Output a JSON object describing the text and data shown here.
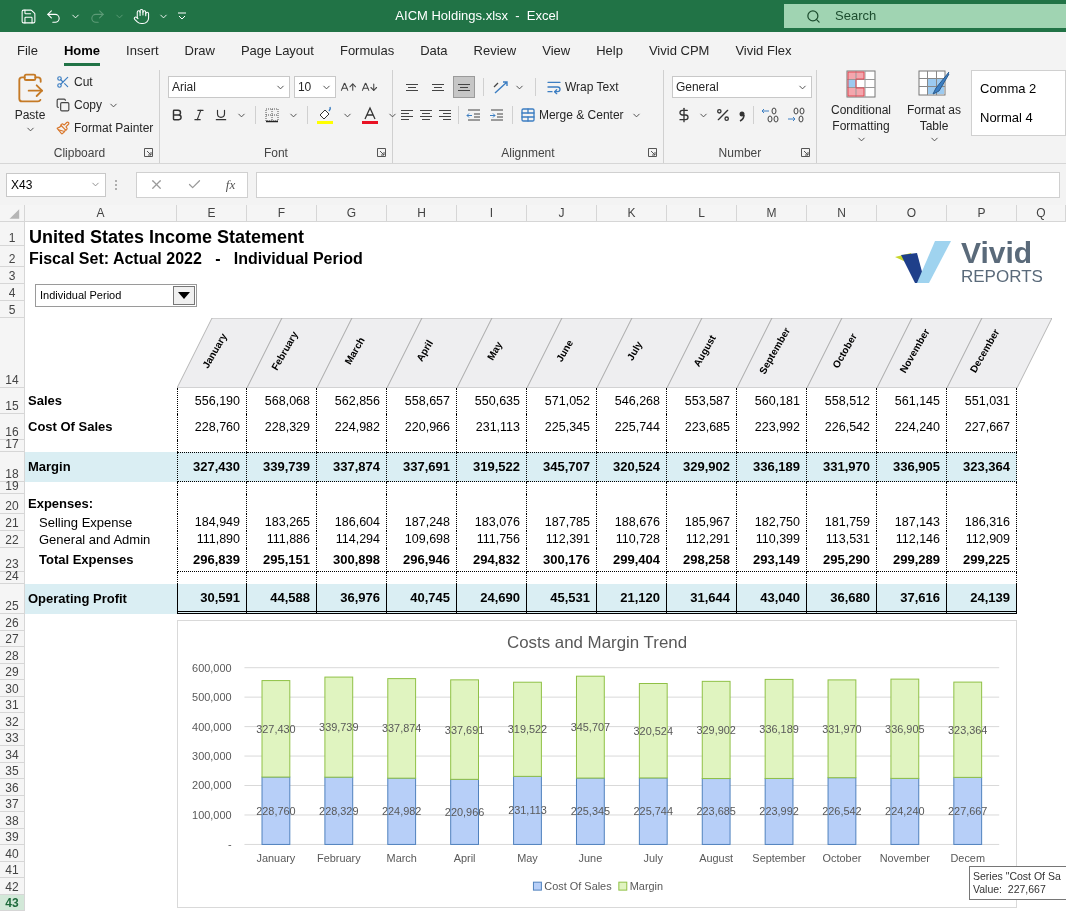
{
  "title_bar": {
    "title": "AICM Holdings.xlsx  -  Excel",
    "search_placeholder": "Search"
  },
  "tabs": [
    {
      "label": "File",
      "selected": false
    },
    {
      "label": "Home",
      "selected": true
    },
    {
      "label": "Insert",
      "selected": false
    },
    {
      "label": "Draw",
      "selected": false
    },
    {
      "label": "Page Layout",
      "selected": false
    },
    {
      "label": "Formulas",
      "selected": false
    },
    {
      "label": "Data",
      "selected": false
    },
    {
      "label": "Review",
      "selected": false
    },
    {
      "label": "View",
      "selected": false
    },
    {
      "label": "Help",
      "selected": false
    },
    {
      "label": "Vivid CPM",
      "selected": false
    },
    {
      "label": "Vivid Flex",
      "selected": false
    }
  ],
  "ribbon": {
    "clipboard": {
      "paste": "Paste",
      "cut": "Cut",
      "copy": "Copy",
      "format_painter": "Format Painter",
      "group": "Clipboard"
    },
    "font": {
      "name": "Arial",
      "size": "10",
      "group": "Font"
    },
    "alignment": {
      "vertical_buttons": [
        {
          "selected": false
        },
        {
          "selected": false
        },
        {
          "selected": true
        }
      ],
      "wrap": "Wrap Text",
      "merge": "Merge & Center",
      "group": "Alignment"
    },
    "number": {
      "format": "General",
      "group": "Number"
    },
    "styles": {
      "conditional": "Conditional Formatting",
      "format_table": "Format as Table",
      "gallery": [
        "Comma 2",
        "Normal 4"
      ]
    }
  },
  "formula_bar": {
    "name_box": "X43",
    "function_label": "fx"
  },
  "column_headers": [
    "A",
    "E",
    "F",
    "G",
    "H",
    "I",
    "J",
    "K",
    "L",
    "M",
    "N",
    "O",
    "P",
    "Q"
  ],
  "sheet": {
    "dropdown": "Individual Period",
    "logo": {
      "word": "Vivid",
      "tagline": "REPORTS"
    },
    "months": [
      "January",
      "February",
      "March",
      "April",
      "May",
      "June",
      "July",
      "August",
      "September",
      "October",
      "November",
      "December"
    ],
    "rows": [
      {
        "num": "1",
        "kind": "title",
        "label": "United States Income Statement"
      },
      {
        "num": "2",
        "kind": "subtitle",
        "label": "Fiscal Set: Actual 2022   -   Individual Period"
      },
      {
        "num": "3",
        "kind": "blank"
      },
      {
        "num": "4",
        "kind": "blank"
      },
      {
        "num": "5",
        "kind": "blank"
      },
      {
        "num": "14",
        "kind": "header"
      },
      {
        "num": "15",
        "kind": "line",
        "label": "Sales",
        "values": [
          "556,190",
          "568,068",
          "562,856",
          "558,657",
          "550,635",
          "571,052",
          "546,268",
          "553,587",
          "560,181",
          "558,512",
          "561,145",
          "551,031"
        ]
      },
      {
        "num": "16",
        "kind": "line",
        "label": "Cost Of Sales",
        "values": [
          "228,760",
          "228,329",
          "224,982",
          "220,966",
          "231,113",
          "225,345",
          "225,744",
          "223,685",
          "223,992",
          "226,542",
          "224,240",
          "227,667"
        ]
      },
      {
        "num": "17",
        "kind": "gap"
      },
      {
        "num": "18",
        "kind": "highlight",
        "label": "Margin",
        "values": [
          "327,430",
          "339,739",
          "337,874",
          "337,691",
          "319,522",
          "345,707",
          "320,524",
          "329,902",
          "336,189",
          "331,970",
          "336,905",
          "323,364"
        ]
      },
      {
        "num": "19",
        "kind": "gap"
      },
      {
        "num": "20",
        "kind": "heading",
        "label": "Expenses:"
      },
      {
        "num": "21",
        "kind": "detail",
        "label": "Selling Expense",
        "values": [
          "184,949",
          "183,265",
          "186,604",
          "187,248",
          "183,076",
          "187,785",
          "188,676",
          "185,967",
          "182,750",
          "181,759",
          "187,143",
          "186,316"
        ]
      },
      {
        "num": "22",
        "kind": "detail",
        "label": "General and Admin",
        "values": [
          "111,890",
          "111,886",
          "114,294",
          "109,698",
          "111,756",
          "112,391",
          "110,728",
          "112,291",
          "110,399",
          "113,531",
          "112,146",
          "112,909"
        ]
      },
      {
        "num": "23",
        "kind": "total",
        "label": "Total Expenses",
        "values": [
          "296,839",
          "295,151",
          "300,898",
          "296,946",
          "294,832",
          "300,176",
          "299,404",
          "298,258",
          "293,149",
          "295,290",
          "299,289",
          "299,225"
        ]
      },
      {
        "num": "24",
        "kind": "gap"
      },
      {
        "num": "25",
        "kind": "result",
        "label": "Operating Profit",
        "values": [
          "30,591",
          "44,588",
          "36,976",
          "40,745",
          "24,690",
          "45,531",
          "21,120",
          "31,644",
          "43,040",
          "36,680",
          "37,616",
          "24,139"
        ]
      }
    ],
    "lower_rows": [
      {
        "num": "26",
        "selected": false
      },
      {
        "num": "27",
        "selected": false
      },
      {
        "num": "28",
        "selected": false
      },
      {
        "num": "29",
        "selected": false
      },
      {
        "num": "30",
        "selected": false
      },
      {
        "num": "31",
        "selected": false
      },
      {
        "num": "32",
        "selected": false
      },
      {
        "num": "33",
        "selected": false
      },
      {
        "num": "34",
        "selected": false
      },
      {
        "num": "35",
        "selected": false
      },
      {
        "num": "36",
        "selected": false
      },
      {
        "num": "37",
        "selected": false
      },
      {
        "num": "38",
        "selected": false
      },
      {
        "num": "39",
        "selected": false
      },
      {
        "num": "40",
        "selected": false
      },
      {
        "num": "41",
        "selected": false
      },
      {
        "num": "42",
        "selected": false
      },
      {
        "num": "43",
        "selected": true
      }
    ],
    "chart": {
      "chart_data": {
        "type": "bar",
        "title": "Costs and Margin Trend",
        "categories": [
          "January",
          "February",
          "March",
          "April",
          "May",
          "June",
          "July",
          "August",
          "September",
          "October",
          "November",
          "Decem"
        ],
        "stacked": true,
        "data_labels": true,
        "grid": true,
        "legend": "bottom",
        "ylim": [
          0,
          600000
        ],
        "yticks": [
          {
            "value": 0,
            "label": "-"
          },
          {
            "value": 100000,
            "label": "100,000"
          },
          {
            "value": 200000,
            "label": "200,000"
          },
          {
            "value": 300000,
            "label": "300,000"
          },
          {
            "value": 400000,
            "label": "400,000"
          },
          {
            "value": 500000,
            "label": "500,000"
          },
          {
            "value": 600000,
            "label": "600,000"
          }
        ],
        "series": [
          {
            "name": "Cost Of Sales",
            "color": "#b7cff8",
            "values": [
              228760,
              228329,
              224982,
              220966,
              231113,
              225345,
              225744,
              223685,
              223992,
              226542,
              224240,
              227667
            ],
            "value_labels": [
              "228,760",
              "228,329",
              "224,982",
              "220,966",
              "231,113",
              "225,345",
              "225,744",
              "223,685",
              "223,992",
              "226,542",
              "224,240",
              "227,667"
            ]
          },
          {
            "name": "Margin",
            "color": "#e0f4c0",
            "values": [
              327430,
              339739,
              337874,
              337691,
              319522,
              345707,
              320524,
              329902,
              336189,
              331970,
              336905,
              323364
            ],
            "value_labels": [
              "327,430",
              "339,739",
              "337,874",
              "337,691",
              "319,522",
              "345,707",
              "320,524",
              "329,902",
              "336,189",
              "331,970",
              "336,905",
              "323,364"
            ]
          }
        ]
      },
      "tooltip": [
        "Series \"Cost Of Sa",
        "Value:  227,667"
      ]
    }
  }
}
